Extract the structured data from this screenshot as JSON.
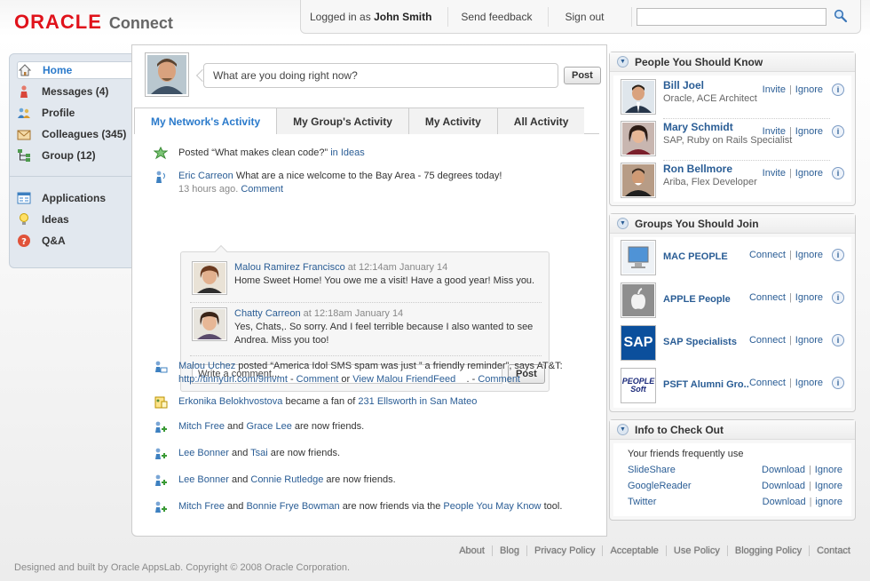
{
  "header": {
    "logo_brand": "ORACLE",
    "logo_app": "Connect",
    "logged_prefix": "Logged in as",
    "user_name": "John Smith",
    "send_feedback": "Send feedback",
    "sign_out": "Sign out",
    "search_placeholder": ""
  },
  "nav": {
    "items": [
      {
        "label": "Home",
        "icon": "home-icon"
      },
      {
        "label": "Messages (4)",
        "icon": "messages-icon"
      },
      {
        "label": "Profile",
        "icon": "profile-icon"
      },
      {
        "label": "Colleagues (345)",
        "icon": "colleagues-icon"
      },
      {
        "label": "Group (12)",
        "icon": "group-icon"
      },
      {
        "label": "Applications",
        "icon": "applications-icon"
      },
      {
        "label": "Ideas",
        "icon": "lightbulb-icon"
      },
      {
        "label": "Q&A",
        "icon": "question-icon"
      }
    ]
  },
  "status": {
    "placeholder": "What are you doing right now?",
    "post_label": "Post"
  },
  "tabs": [
    "My Network's Activity",
    "My Group's Activity",
    "My Activity",
    "All Activity"
  ],
  "feed": {
    "item1": {
      "text": "Posted “What makes clean code?”",
      "link": "in Ideas"
    },
    "item2": {
      "name": "Eric Carreon",
      "text": "What are a nice welcome to the Bay Area - 75 degrees today!",
      "time": "13 hours ago.",
      "comment_link": "Comment"
    },
    "comments": [
      {
        "name": "Malou Ramirez Francisco",
        "time": "at 12:14am January 14",
        "text": "Home Sweet Home! You owe me a visit! Have a good year! Miss you."
      },
      {
        "name": "Chatty Carreon",
        "time": "at 12:18am January 14",
        "text": "Yes, Chats,. So sorry. And I feel terrible because I also wanted to see Andrea. Miss you too!"
      }
    ],
    "comment_placeholder": "Write a comment...",
    "comment_post": "Post",
    "item3": {
      "name": "Malou Uchez",
      "text": "posted “America Idol SMS spam was just ” a friendly reminder”, says AT&T:",
      "url": "http://tinnyurl.com/9mvmt",
      "dash1": "-",
      "comment1": "Comment",
      "or": "or",
      "view": "View Malou FriendFeed",
      "dash2": ". -",
      "comment2": "Comment"
    },
    "item4": {
      "name": "Erkonika Belokhvostova",
      "text": "became a fan of",
      "link": "231 Ellsworth in San Mateo"
    },
    "item5": {
      "a": "Mitch Free",
      "and": "and",
      "b": "Grace Lee",
      "text": "are now friends."
    },
    "item6": {
      "a": "Lee Bonner",
      "and": "and",
      "b": "Tsai",
      "text": "are now friends."
    },
    "item7": {
      "a": "Lee Bonner",
      "and": "and",
      "b": "Connie Rutledge",
      "text": "are now friends."
    },
    "item8": {
      "a": "Mitch Free",
      "and": "and",
      "b": "Bonnie Frye Bowman",
      "text": "are now friends via the",
      "link": "People You May Know",
      "tail": "tool."
    }
  },
  "people_panel": {
    "title": "People You Should Know",
    "people": [
      {
        "name": "Bill Joel",
        "sub": "Oracle, ACE Architect",
        "invite": "Invite",
        "ignore": "Ignore"
      },
      {
        "name": "Mary Schmidt",
        "sub": "SAP, Ruby on Rails Specialist",
        "invite": "Invite",
        "ignore": "Ignore"
      },
      {
        "name": "Ron Bellmore",
        "sub": "Ariba, Flex Developer",
        "invite": "Invite",
        "ignore": "Ignore"
      }
    ],
    "sep": "|"
  },
  "groups_panel": {
    "title": "Groups You Should Join",
    "groups": [
      {
        "name": "MAC PEOPLE",
        "connect": "Connect",
        "ignore": "Ignore"
      },
      {
        "name": "APPLE People",
        "connect": "Connect",
        "ignore": "Ignore"
      },
      {
        "name": "SAP Specialists",
        "connect": "Connect",
        "ignore": "Ignore",
        "logo_text": "SAP"
      },
      {
        "name": "PSFT Alumni Gro..",
        "connect": "Connect",
        "ignore": "Ignore",
        "logo_text": "PEOPLE Soft"
      }
    ]
  },
  "info_panel": {
    "title": "Info to Check Out",
    "intro": "Your friends frequently use",
    "apps": [
      {
        "name": "SlideShare",
        "download": "Download",
        "ignore": "Ignore"
      },
      {
        "name": "GoogleReader",
        "download": "Download",
        "ignore": "Ignore"
      },
      {
        "name": "Twitter",
        "download": "Download",
        "ignore": "ignore"
      }
    ]
  },
  "footer": {
    "links": [
      "About",
      "Blog",
      "Privacy Policy",
      "Acceptable",
      "Use Policy",
      "Blogging Policy",
      "Contact"
    ],
    "copyright": "Designed and built by Oracle AppsLab. Copyright © 2008 Oracle Corporation."
  },
  "colors": {
    "brand_red": "#e0121b",
    "link_blue": "#2a5d95",
    "active_blue": "#2a7acb"
  }
}
